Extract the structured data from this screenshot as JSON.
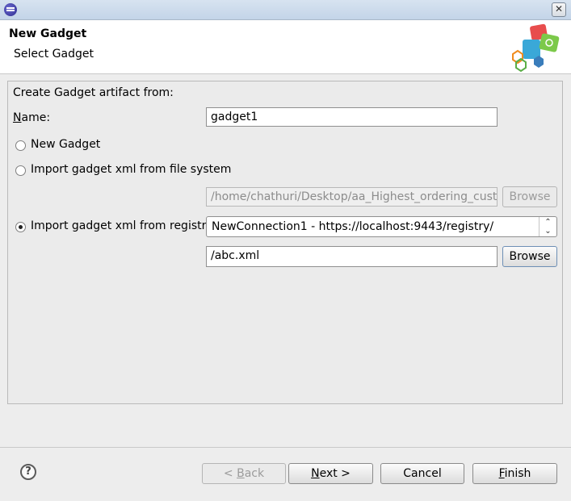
{
  "window": {
    "title": "",
    "close_glyph": "✕"
  },
  "banner": {
    "title": "New Gadget",
    "subtitle": "Select Gadget",
    "image_icon": "gadget-wizard-icon"
  },
  "form": {
    "group_label": "Create Gadget artifact from:",
    "name_label_mnemonic": "N",
    "name_label_rest": "ame:",
    "name_value": "gadget1",
    "options": [
      {
        "label": "New Gadget",
        "checked": false
      },
      {
        "label": "Import gadget xml from file system",
        "checked": false
      },
      {
        "label": "Import gadget xml from registry",
        "checked": true
      }
    ],
    "file_path_value": "/home/chathuri/Desktop/aa_Highest_ordering_customers",
    "file_browse_label": "Browse",
    "registry_connection_value": "NewConnection1 - https://localhost:9443/registry/",
    "registry_path_value": "/abc.xml",
    "registry_browse_label": "Browse"
  },
  "footer": {
    "help_glyph": "?",
    "back_prefix": "< ",
    "back_mnemonic": "B",
    "back_rest": "ack",
    "next_mnemonic": "N",
    "next_rest": "ext >",
    "cancel_label": "Cancel",
    "finish_mnemonic": "F",
    "finish_rest": "inish"
  }
}
